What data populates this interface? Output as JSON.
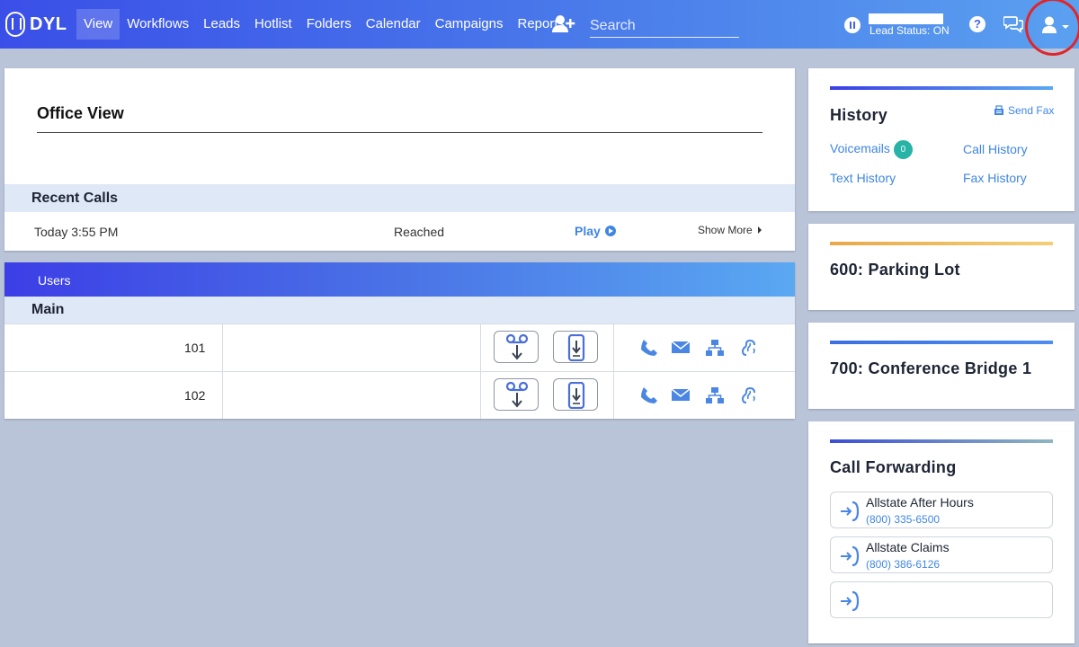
{
  "brand": {
    "logo_text": "DYL"
  },
  "nav": {
    "items": [
      {
        "label": "View",
        "active": true
      },
      {
        "label": "Workflows"
      },
      {
        "label": "Leads"
      },
      {
        "label": "Hotlist"
      },
      {
        "label": "Folders"
      },
      {
        "label": "Calendar"
      },
      {
        "label": "Campaigns"
      },
      {
        "label": "Reports"
      }
    ],
    "search_placeholder": "Search",
    "lead_status": "Lead Status: ON",
    "help_label": "?"
  },
  "office": {
    "title": "Office View",
    "recent_calls": {
      "title": "Recent Calls",
      "time": "Today 3:55 PM",
      "status": "Reached",
      "play_label": "Play",
      "show_more_label": "Show More"
    }
  },
  "users": {
    "title": "Users",
    "group": "Main",
    "rows": [
      {
        "ext": "101"
      },
      {
        "ext": "102"
      }
    ]
  },
  "history": {
    "title": "History",
    "send_fax": "Send Fax",
    "voicemails": "Voicemails",
    "voicemail_count": "0",
    "call_history": "Call History",
    "text_history": "Text History",
    "fax_history": "Fax History"
  },
  "parking": {
    "title": "600: Parking Lot"
  },
  "conference": {
    "title": "700: Conference Bridge 1"
  },
  "forwarding": {
    "title": "Call Forwarding",
    "items": [
      {
        "name": "Allstate After Hours",
        "number": "(800) 335-6500"
      },
      {
        "name": "Allstate Claims",
        "number": "(800) 386-6126"
      },
      {
        "name": "",
        "number": ""
      }
    ]
  },
  "colors": {
    "accent_blue": "#3f86e3",
    "nav_gradient_start": "#3a4fe8",
    "nav_gradient_end": "#5aa0f0",
    "badge_teal": "#28b3a7",
    "parking_accent": "#e8a94a",
    "profile_highlight": "#e0262a"
  }
}
